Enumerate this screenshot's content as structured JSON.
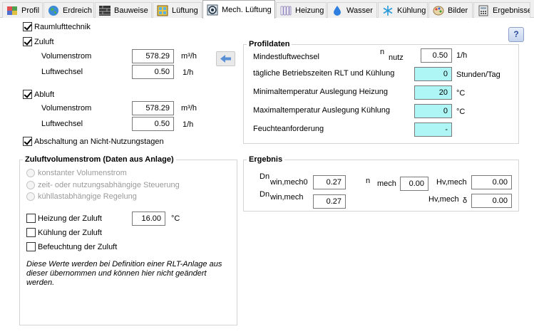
{
  "tabs": [
    {
      "label": "Profil",
      "icon": "profile-icon"
    },
    {
      "label": "Erdreich",
      "icon": "globe-icon"
    },
    {
      "label": "Bauweise",
      "icon": "wall-icon"
    },
    {
      "label": "Lüftung",
      "icon": "window-icon"
    },
    {
      "label": "Mech. Lüftung",
      "icon": "ventilation-icon"
    },
    {
      "label": "Heizung",
      "icon": "radiator-icon"
    },
    {
      "label": "Wasser",
      "icon": "water-drop-icon"
    },
    {
      "label": "Kühlung",
      "icon": "snowflake-icon"
    },
    {
      "label": "Bilder",
      "icon": "palette-icon"
    },
    {
      "label": "Ergebnisse",
      "icon": "calculator-icon"
    }
  ],
  "active_tab": "Mech. Lüftung",
  "left": {
    "raumlufttechnik": "Raumlufttechnik",
    "zuluft": "Zuluft",
    "abluft": "Abluft",
    "volumenstrom_label": "Volumenstrom",
    "luftwechsel_label": "Luftwechsel",
    "zuluft_volumenstrom": "578.29",
    "zuluft_luftwechsel": "0.50",
    "abluft_volumenstrom": "578.29",
    "abluft_luftwechsel": "0.50",
    "unit_m3h": "m³/h",
    "unit_1h": "1/h",
    "abschaltung": "Abschaltung an Nicht-Nutzungstagen"
  },
  "zuluftgroup": {
    "title": "Zuluftvolumenstrom (Daten aus Anlage)",
    "radio1": "konstanter Volumenstrom",
    "radio2": "zeit- oder nutzungsabhängige Steuerung",
    "radio3": "kühllastabhängige Regelung",
    "heizung": "Heizung der Zuluft",
    "heizung_value": "16.00",
    "unit_c": "°C",
    "kuehlung": "Kühlung der Zuluft",
    "befeuchtung": "Befeuchtung der Zuluft",
    "note": "Diese Werte werden bei Definition einer RLT-Anlage aus dieser übernommen und können hier nicht geändert werden."
  },
  "profil": {
    "title": "Profildaten",
    "mindest_label": "Mindestluftwechsel",
    "n_sym": "n",
    "n_sub": "nutz",
    "mindest_value": "0.50",
    "mindest_unit": "1/h",
    "betrieb_label": "tägliche Betriebszeiten RLT und Kühlung",
    "betrieb_value": "0",
    "betrieb_unit": "Stunden/Tag",
    "mintemp_label": "Minimaltemperatur Auslegung Heizung",
    "mintemp_value": "20",
    "maxtemp_label": "Maximaltemperatur Auslegung Kühlung",
    "maxtemp_value": "0",
    "temp_unit": "°C",
    "feuchte_label": "Feuchteanforderung",
    "feuchte_value": "-"
  },
  "ergebnis": {
    "title": "Ergebnis",
    "dn1_sym": "Dn",
    "dn1_sub": "win,mech0",
    "dn1_value": "0.27",
    "dn2_sym": "Dn",
    "dn2_sub": "win,mech",
    "dn2_value": "0.27",
    "nmech_sym": "n",
    "nmech_sub": "mech",
    "nmech_value": "0.00",
    "hv1_label": "Hv,mech",
    "hv1_value": "0.00",
    "hv2_label": "Hv,mech",
    "hv2_delta": "δ",
    "hv2_value": "0.00"
  },
  "help_label": "?",
  "colors": {
    "cyan_field": "#aef6f6",
    "arrow_blue": "#5a8fd6"
  }
}
